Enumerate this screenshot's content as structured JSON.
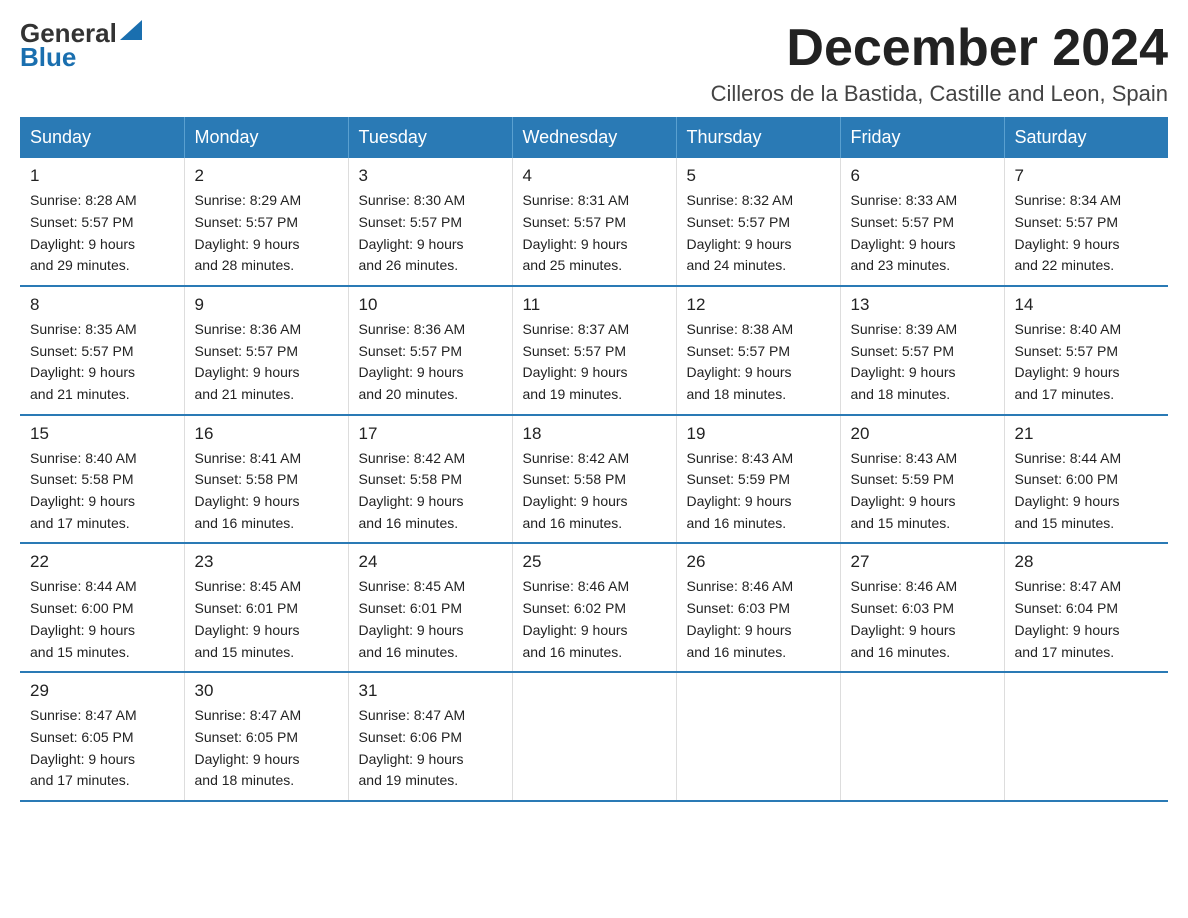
{
  "logo": {
    "part1": "General",
    "triangle": "▶",
    "part2": "Blue"
  },
  "title": "December 2024",
  "subtitle": "Cilleros de la Bastida, Castille and Leon, Spain",
  "weekdays": [
    "Sunday",
    "Monday",
    "Tuesday",
    "Wednesday",
    "Thursday",
    "Friday",
    "Saturday"
  ],
  "weeks": [
    [
      {
        "day": "1",
        "sunrise": "8:28 AM",
        "sunset": "5:57 PM",
        "daylight": "9 hours and 29 minutes."
      },
      {
        "day": "2",
        "sunrise": "8:29 AM",
        "sunset": "5:57 PM",
        "daylight": "9 hours and 28 minutes."
      },
      {
        "day": "3",
        "sunrise": "8:30 AM",
        "sunset": "5:57 PM",
        "daylight": "9 hours and 26 minutes."
      },
      {
        "day": "4",
        "sunrise": "8:31 AM",
        "sunset": "5:57 PM",
        "daylight": "9 hours and 25 minutes."
      },
      {
        "day": "5",
        "sunrise": "8:32 AM",
        "sunset": "5:57 PM",
        "daylight": "9 hours and 24 minutes."
      },
      {
        "day": "6",
        "sunrise": "8:33 AM",
        "sunset": "5:57 PM",
        "daylight": "9 hours and 23 minutes."
      },
      {
        "day": "7",
        "sunrise": "8:34 AM",
        "sunset": "5:57 PM",
        "daylight": "9 hours and 22 minutes."
      }
    ],
    [
      {
        "day": "8",
        "sunrise": "8:35 AM",
        "sunset": "5:57 PM",
        "daylight": "9 hours and 21 minutes."
      },
      {
        "day": "9",
        "sunrise": "8:36 AM",
        "sunset": "5:57 PM",
        "daylight": "9 hours and 21 minutes."
      },
      {
        "day": "10",
        "sunrise": "8:36 AM",
        "sunset": "5:57 PM",
        "daylight": "9 hours and 20 minutes."
      },
      {
        "day": "11",
        "sunrise": "8:37 AM",
        "sunset": "5:57 PM",
        "daylight": "9 hours and 19 minutes."
      },
      {
        "day": "12",
        "sunrise": "8:38 AM",
        "sunset": "5:57 PM",
        "daylight": "9 hours and 18 minutes."
      },
      {
        "day": "13",
        "sunrise": "8:39 AM",
        "sunset": "5:57 PM",
        "daylight": "9 hours and 18 minutes."
      },
      {
        "day": "14",
        "sunrise": "8:40 AM",
        "sunset": "5:57 PM",
        "daylight": "9 hours and 17 minutes."
      }
    ],
    [
      {
        "day": "15",
        "sunrise": "8:40 AM",
        "sunset": "5:58 PM",
        "daylight": "9 hours and 17 minutes."
      },
      {
        "day": "16",
        "sunrise": "8:41 AM",
        "sunset": "5:58 PM",
        "daylight": "9 hours and 16 minutes."
      },
      {
        "day": "17",
        "sunrise": "8:42 AM",
        "sunset": "5:58 PM",
        "daylight": "9 hours and 16 minutes."
      },
      {
        "day": "18",
        "sunrise": "8:42 AM",
        "sunset": "5:58 PM",
        "daylight": "9 hours and 16 minutes."
      },
      {
        "day": "19",
        "sunrise": "8:43 AM",
        "sunset": "5:59 PM",
        "daylight": "9 hours and 16 minutes."
      },
      {
        "day": "20",
        "sunrise": "8:43 AM",
        "sunset": "5:59 PM",
        "daylight": "9 hours and 15 minutes."
      },
      {
        "day": "21",
        "sunrise": "8:44 AM",
        "sunset": "6:00 PM",
        "daylight": "9 hours and 15 minutes."
      }
    ],
    [
      {
        "day": "22",
        "sunrise": "8:44 AM",
        "sunset": "6:00 PM",
        "daylight": "9 hours and 15 minutes."
      },
      {
        "day": "23",
        "sunrise": "8:45 AM",
        "sunset": "6:01 PM",
        "daylight": "9 hours and 15 minutes."
      },
      {
        "day": "24",
        "sunrise": "8:45 AM",
        "sunset": "6:01 PM",
        "daylight": "9 hours and 16 minutes."
      },
      {
        "day": "25",
        "sunrise": "8:46 AM",
        "sunset": "6:02 PM",
        "daylight": "9 hours and 16 minutes."
      },
      {
        "day": "26",
        "sunrise": "8:46 AM",
        "sunset": "6:03 PM",
        "daylight": "9 hours and 16 minutes."
      },
      {
        "day": "27",
        "sunrise": "8:46 AM",
        "sunset": "6:03 PM",
        "daylight": "9 hours and 16 minutes."
      },
      {
        "day": "28",
        "sunrise": "8:47 AM",
        "sunset": "6:04 PM",
        "daylight": "9 hours and 17 minutes."
      }
    ],
    [
      {
        "day": "29",
        "sunrise": "8:47 AM",
        "sunset": "6:05 PM",
        "daylight": "9 hours and 17 minutes."
      },
      {
        "day": "30",
        "sunrise": "8:47 AM",
        "sunset": "6:05 PM",
        "daylight": "9 hours and 18 minutes."
      },
      {
        "day": "31",
        "sunrise": "8:47 AM",
        "sunset": "6:06 PM",
        "daylight": "9 hours and 19 minutes."
      },
      null,
      null,
      null,
      null
    ]
  ],
  "labels": {
    "sunrise_prefix": "Sunrise: ",
    "sunset_prefix": "Sunset: ",
    "daylight_prefix": "Daylight: "
  }
}
